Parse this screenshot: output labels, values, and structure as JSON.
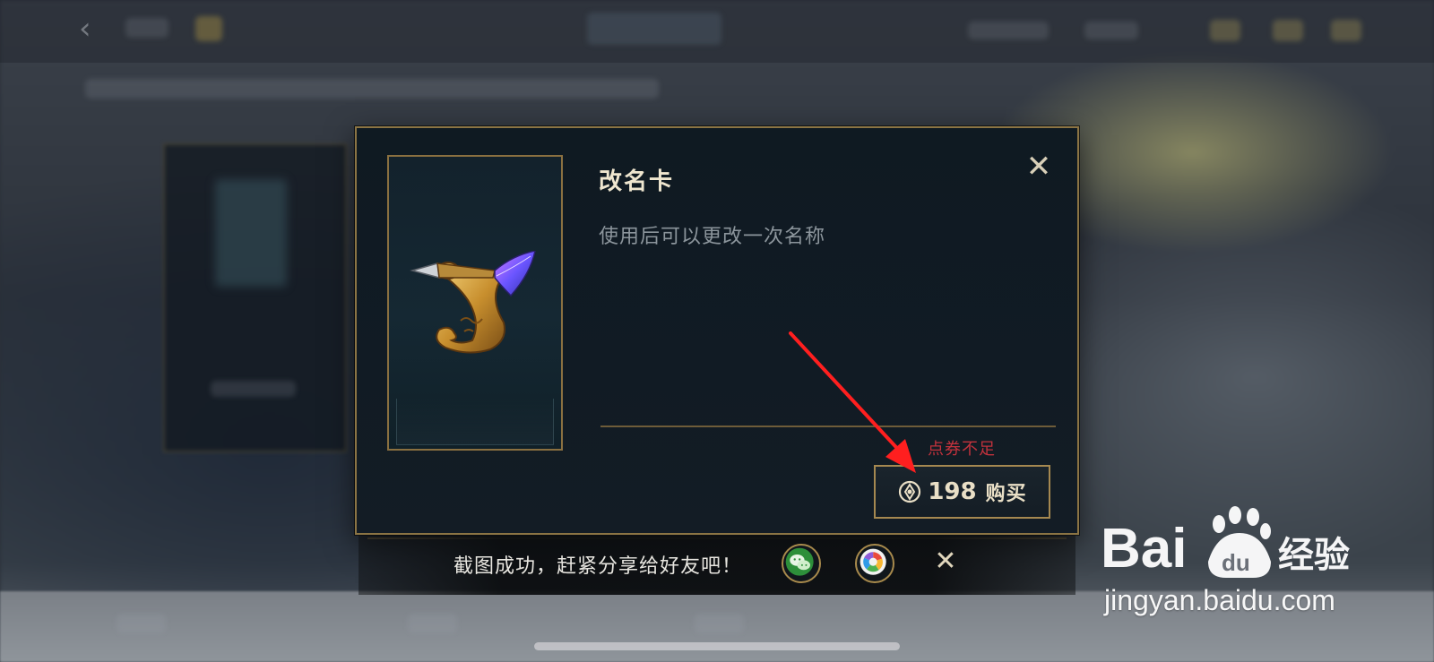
{
  "modal": {
    "title": "改名卡",
    "description": "使用后可以更改一次名称",
    "close_icon": "close-icon",
    "insufficient_notice": "点券不足",
    "buy_button": {
      "currency_icon": "coupon-coin-icon",
      "price": "198",
      "label": "购买"
    },
    "item_icon": "rename-scroll-quill-icon"
  },
  "share_bar": {
    "text": "截图成功，赶紧分享给好友吧！",
    "icons": [
      "wechat-icon",
      "wechat-moments-icon"
    ],
    "close_icon": "close-icon"
  },
  "watermark": {
    "logo_text": "Bai du 经验",
    "url": "jingyan.baidu.com"
  },
  "colors": {
    "accent_gold": "#8b7444",
    "warning_red": "#c2323c",
    "title_text": "#efe6cf",
    "desc_text": "#8c959c"
  }
}
